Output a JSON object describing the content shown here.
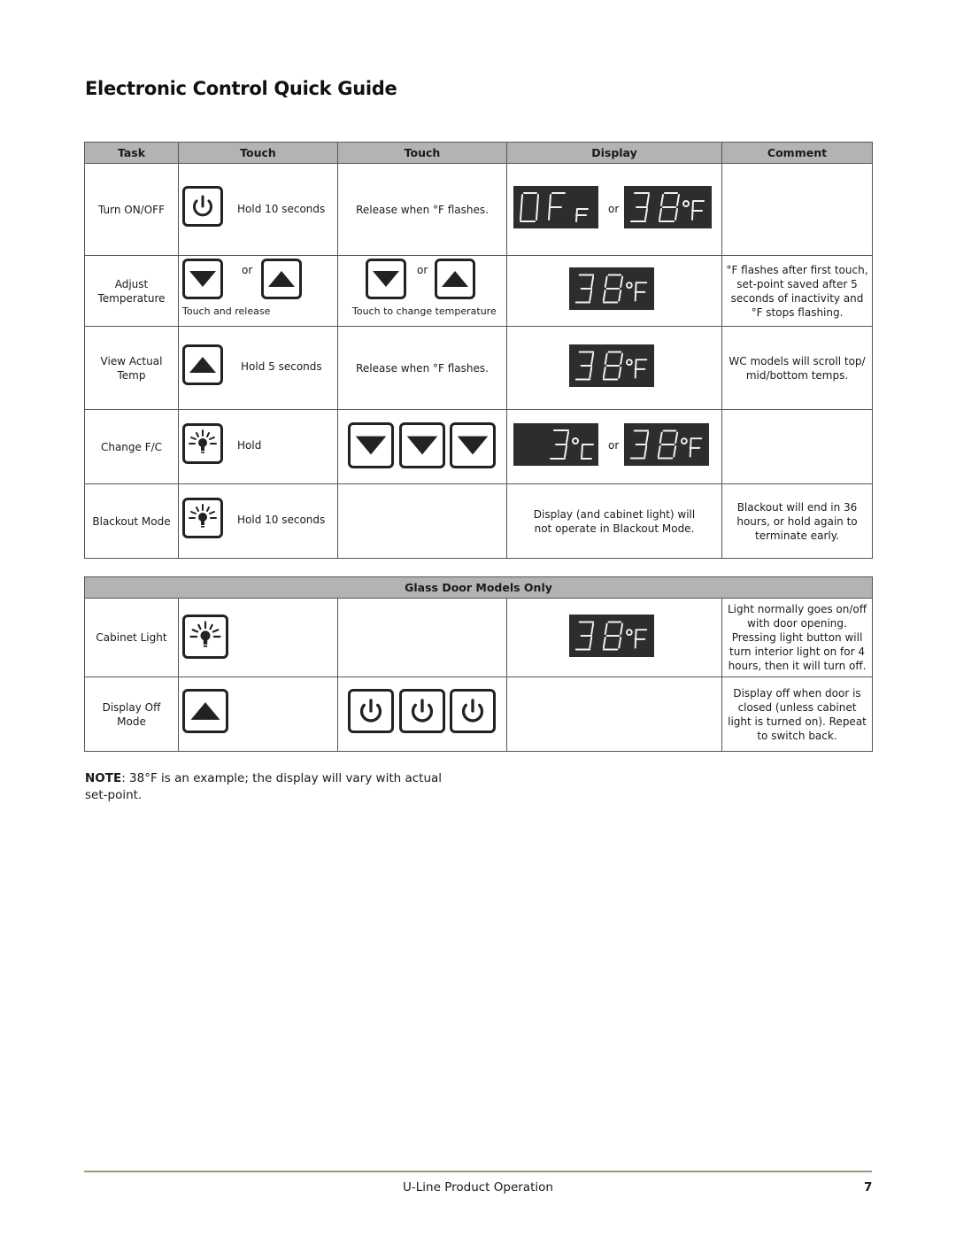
{
  "page": {
    "title": "Electronic Control Quick Guide",
    "note_label": "NOTE",
    "note_text": ": 38°F is an example; the display will vary with actual set-point.",
    "footer": "U-Line Product Operation",
    "page_number": "7",
    "footer_rule_color": "#9b9a7a",
    "header_fill_color": "#b3b3b3",
    "lcd_color": "#2d2d2d"
  },
  "table": {
    "headers": [
      "Task",
      "Touch",
      "Touch",
      "Display",
      "Comment"
    ],
    "rows": [
      {
        "task": "Turn ON/OFF",
        "touch1_icon": "power-icon",
        "touch1_text": "Hold 10 seconds",
        "touch2_text": "Release when °F flashes.",
        "display": [
          "OFF F",
          "38°F"
        ],
        "display_or": "or",
        "comment": ""
      },
      {
        "task": "Adjust Temperature",
        "touch1_icons": [
          "down-arrow-icon",
          "up-arrow-icon"
        ],
        "touch1_or": "or",
        "touch1_caption": "Touch and release",
        "touch2_icons": [
          "down-arrow-icon",
          "up-arrow-icon"
        ],
        "touch2_or": "or",
        "touch2_caption": "Touch to change temperature",
        "display": [
          "38°F"
        ],
        "comment": "°F flashes after first touch, set-point saved after 5 seconds of inactivity and °F stops flashing."
      },
      {
        "task": "View Actual Temp",
        "touch1_icon": "up-arrow-icon",
        "touch1_text": "Hold 5 seconds",
        "touch2_text": "Release when °F flashes.",
        "display": [
          "38°F"
        ],
        "comment": "WC models will scroll top/ mid/bottom temps."
      },
      {
        "task": "Change F/C",
        "touch1_icon": "light-icon",
        "touch1_text": "Hold",
        "touch2_icons": [
          "down-arrow-icon",
          "down-arrow-icon",
          "down-arrow-icon"
        ],
        "display": [
          "3°C",
          "38°F"
        ],
        "display_or": "or",
        "comment": ""
      },
      {
        "task": "Blackout Mode",
        "touch1_icon": "light-icon",
        "touch1_text": "Hold 10 seconds",
        "touch2_text": "",
        "display_text": "Display (and cabinet light) will not operate in Blackout Mode.",
        "comment": "Blackout will end in 36 hours, or hold again to terminate early."
      }
    ]
  },
  "glass_table": {
    "section_title": "Glass Door Models Only",
    "rows": [
      {
        "task": "Cabinet Light",
        "touch1_icon": "light-icon",
        "display": [
          "38°F"
        ],
        "comment": "Light normally goes on/off with door opening. Pressing light button will turn interior light on for 4 hours, then it will turn off."
      },
      {
        "task": "Display Off Mode",
        "touch1_icon": "up-arrow-icon",
        "touch2_icons": [
          "power-icon",
          "power-icon",
          "power-icon"
        ],
        "comment": "Display off when door is closed (unless cabinet light is turned on). Repeat to switch back."
      }
    ]
  }
}
